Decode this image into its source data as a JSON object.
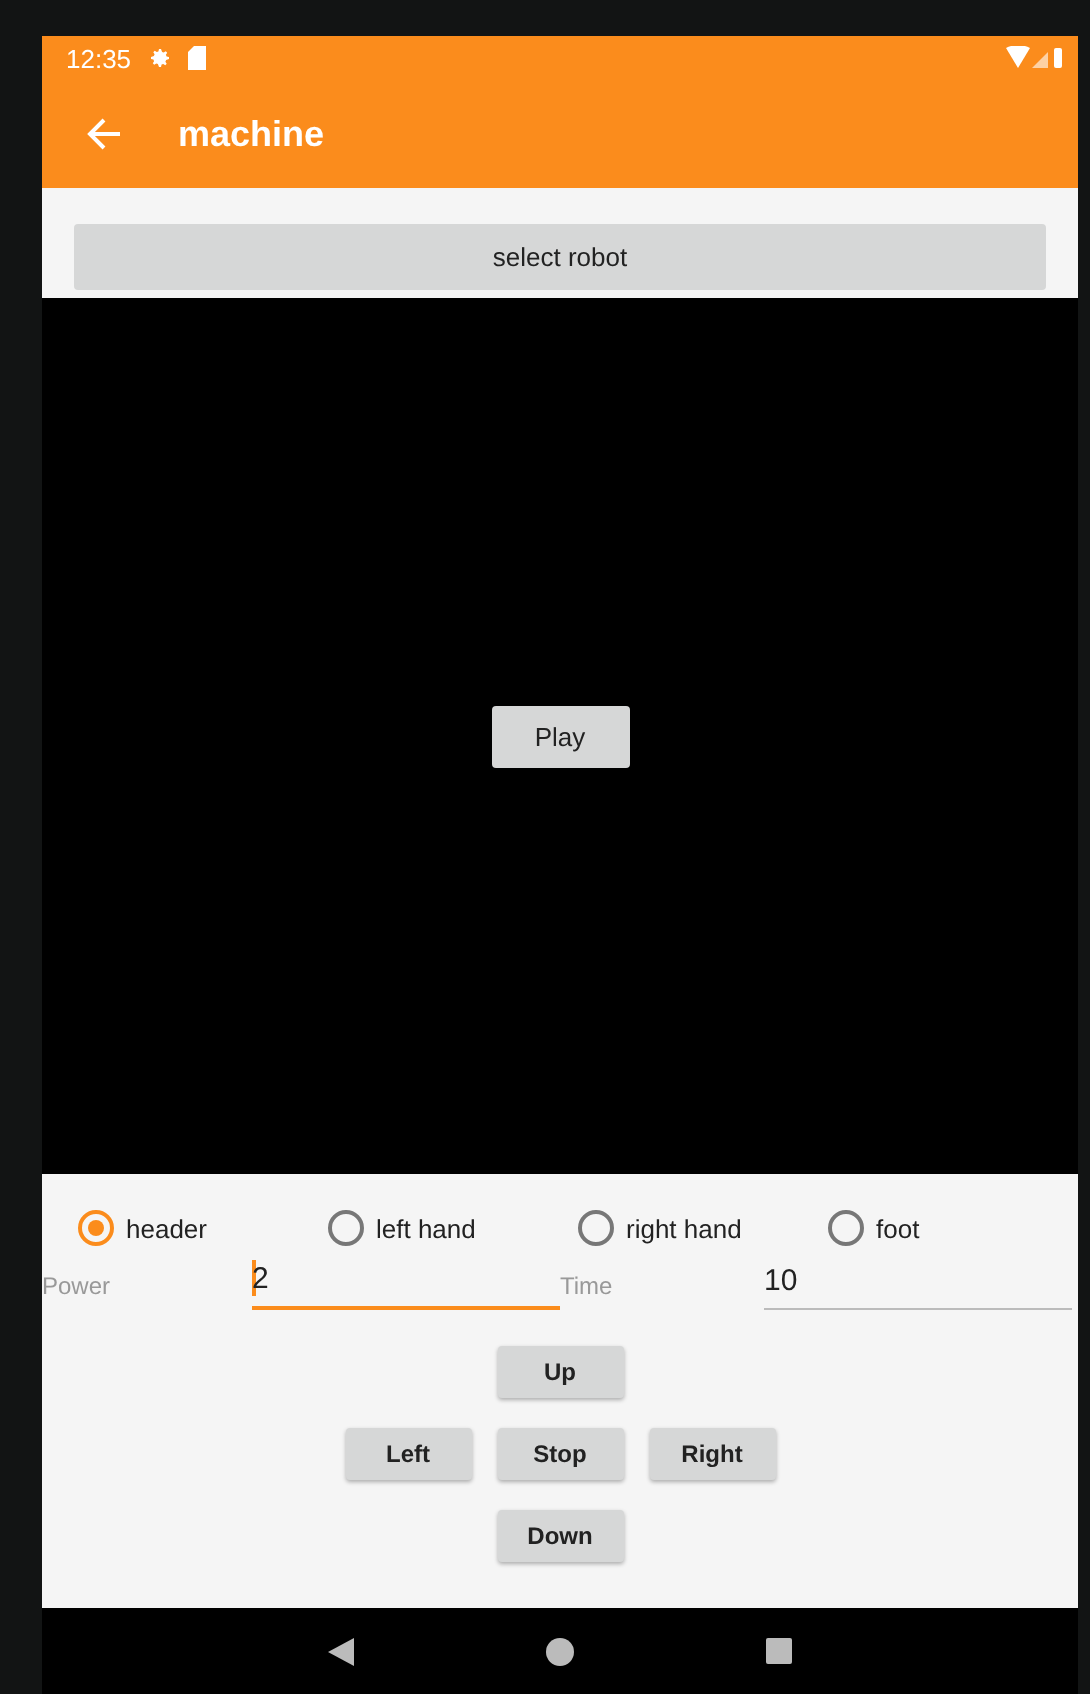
{
  "status_bar": {
    "time": "12:35"
  },
  "app_bar": {
    "title": "machine"
  },
  "select_button": {
    "label": "select robot"
  },
  "video": {
    "play_button": {
      "label": "Play"
    }
  },
  "parts": [
    {
      "label": "header",
      "selected": true
    },
    {
      "label": "left hand",
      "selected": false
    },
    {
      "label": "right hand",
      "selected": false
    },
    {
      "label": "foot",
      "selected": false
    }
  ],
  "fields": [
    {
      "label": "Power",
      "value": "2",
      "focused": true
    },
    {
      "label": "Time",
      "value": "10",
      "focused": false
    }
  ],
  "direction_buttons": [
    {
      "label": "Up",
      "kind": "up"
    },
    {
      "label": "Left",
      "kind": "left"
    },
    {
      "label": "Stop",
      "kind": "stop"
    },
    {
      "label": "Right",
      "kind": "right"
    },
    {
      "label": "Down",
      "kind": "down"
    }
  ]
}
